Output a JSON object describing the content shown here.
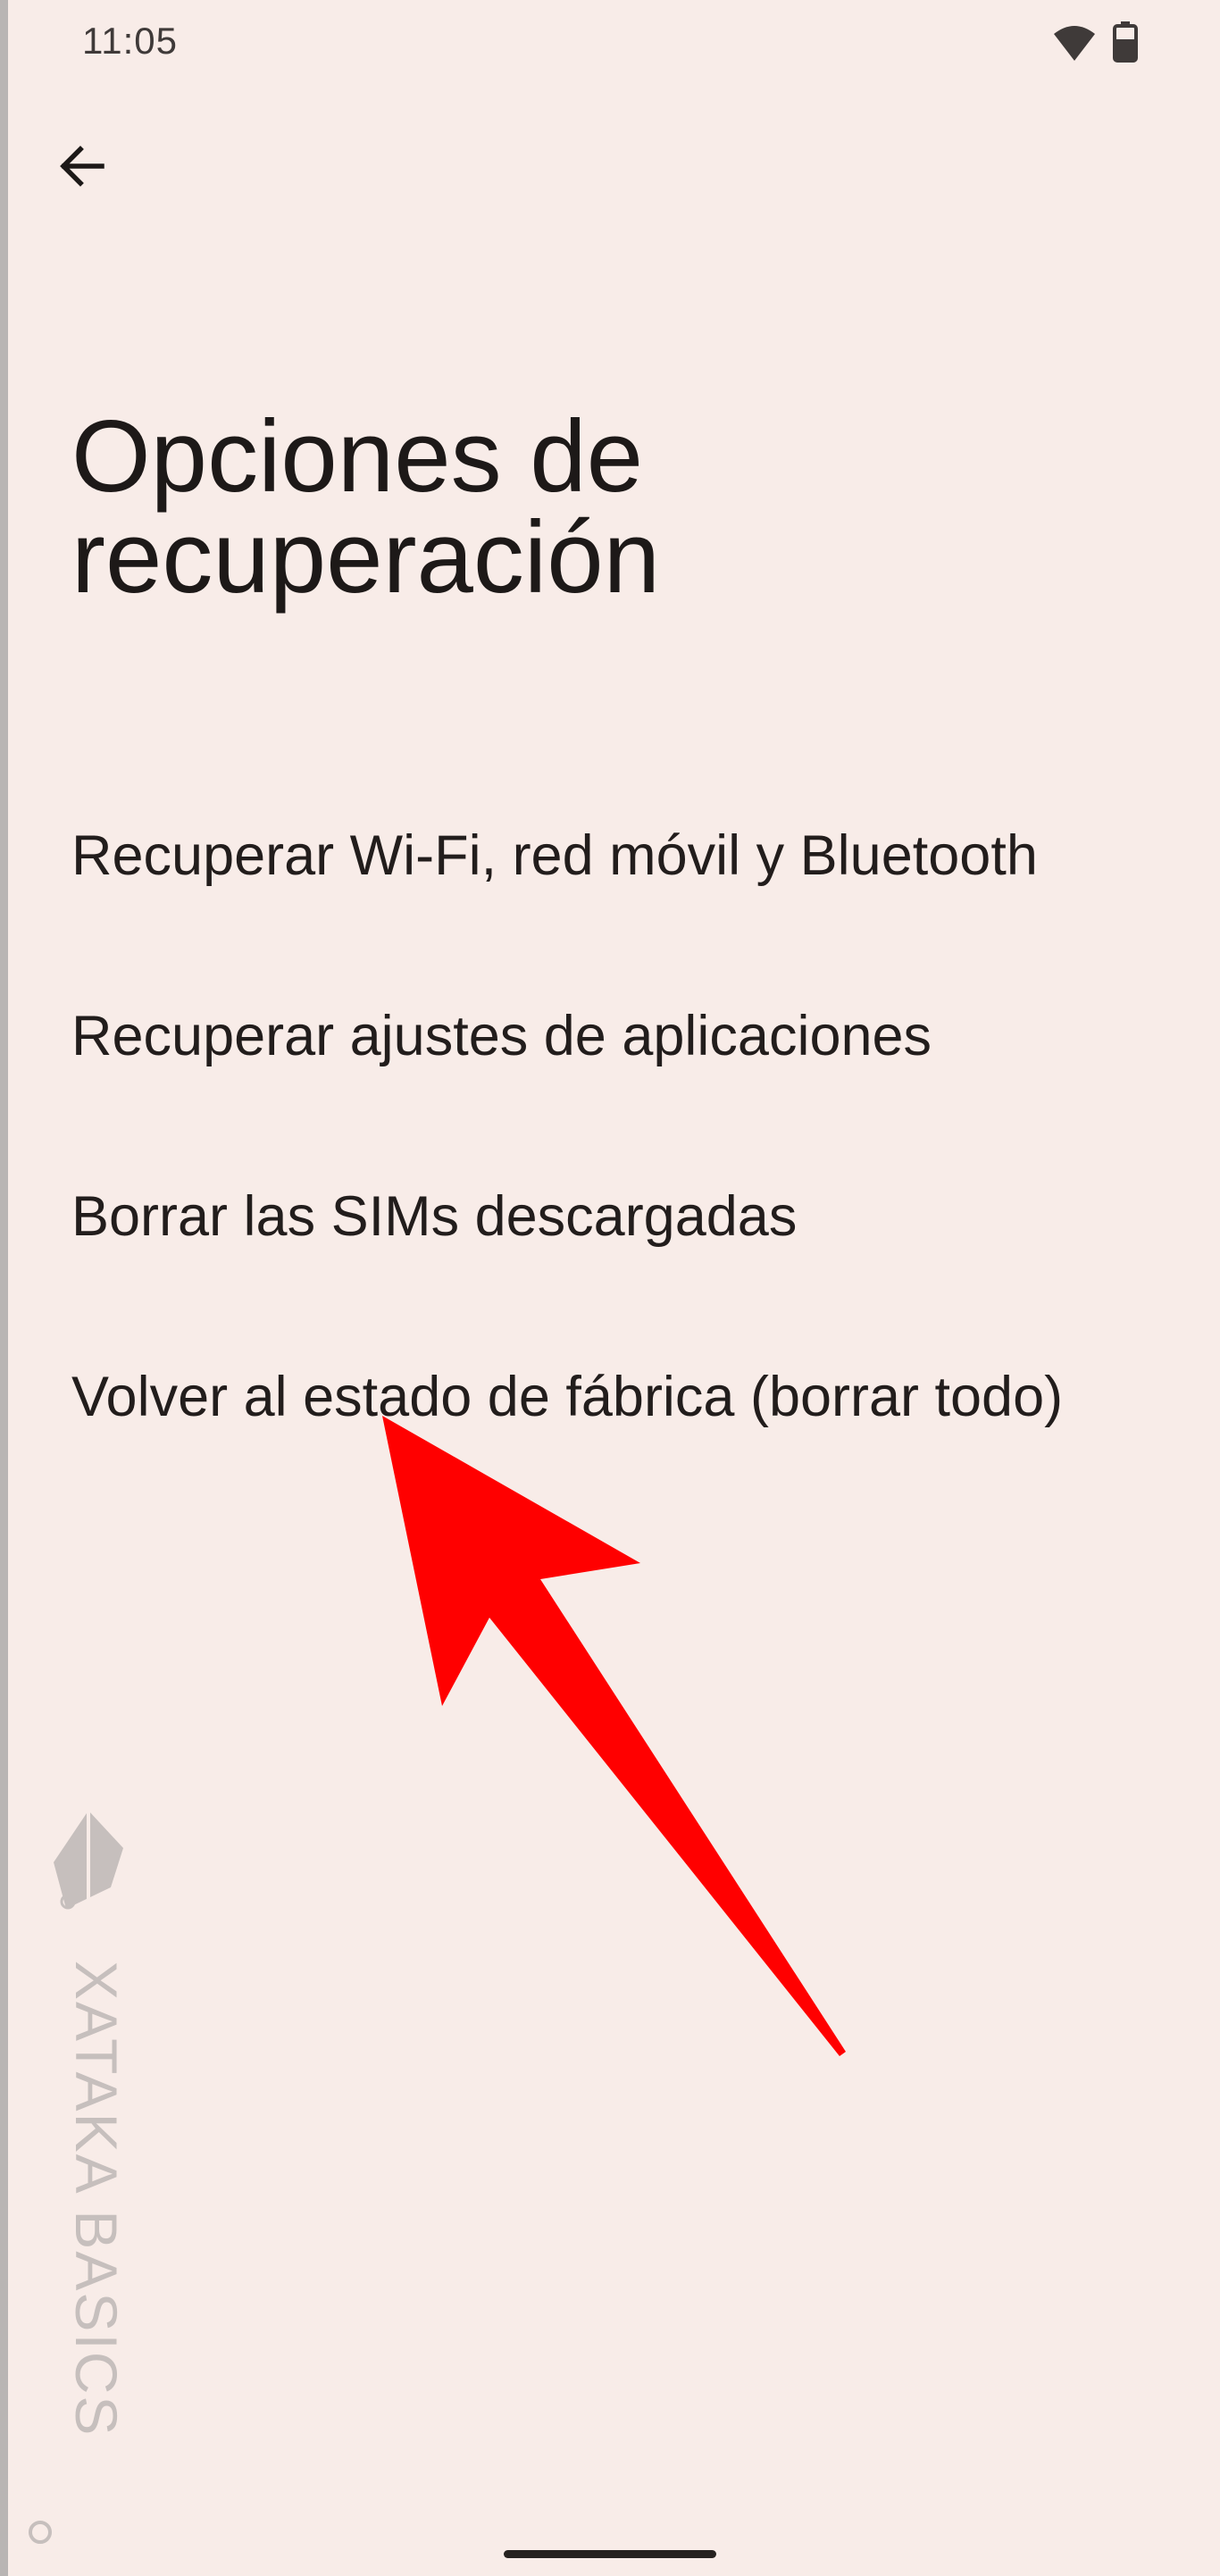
{
  "status_bar": {
    "time": "11:05",
    "icons": [
      "wifi-icon",
      "battery-icon"
    ]
  },
  "header": {
    "back_icon": "arrow-left-icon"
  },
  "page": {
    "title": "Opciones de recuperación"
  },
  "options": [
    {
      "label": "Recuperar Wi-Fi, red móvil y Bluetooth"
    },
    {
      "label": "Recuperar ajustes de aplicaciones"
    },
    {
      "label": "Borrar las SIMs descargadas"
    },
    {
      "label": "Volver al estado de fábrica (borrar todo)"
    }
  ],
  "annotation": {
    "arrow_color": "#ff0000",
    "points_to": "Volver al estado de fábrica (borrar todo)"
  },
  "watermark": {
    "text": "XATAKA BASICS"
  },
  "colors": {
    "background": "#f8ece8",
    "text": "#1f1a19",
    "arrow": "#ff0000"
  }
}
